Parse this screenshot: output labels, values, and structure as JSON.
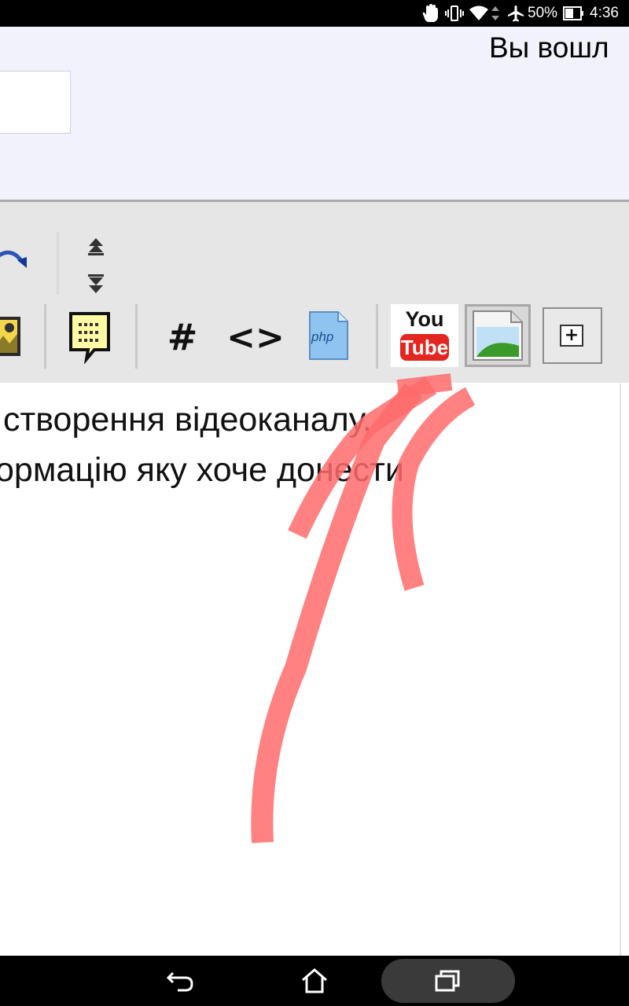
{
  "status_bar": {
    "battery": "50%",
    "time": "4:36",
    "icons": [
      "hand-touch-icon",
      "vibrate-icon",
      "wifi-icon",
      "data-transfer-icon",
      "airplane-icon",
      "battery-icon"
    ]
  },
  "header": {
    "login_text": "Вы вошл"
  },
  "toolbar": {
    "buttons": [
      {
        "name": "redo-icon"
      },
      {
        "name": "collapse-up-icon"
      },
      {
        "name": "expand-down-icon"
      },
      {
        "name": "insert-image-icon"
      },
      {
        "name": "insert-quote-icon"
      },
      {
        "name": "hashtag-icon",
        "label": "#"
      },
      {
        "name": "code-icon",
        "label": "<>"
      },
      {
        "name": "php-icon",
        "label": "php"
      },
      {
        "name": "youtube-icon",
        "top": "You",
        "bottom": "Tube"
      },
      {
        "name": "picture-icon"
      },
      {
        "name": "add-more-icon",
        "label": "+"
      }
    ]
  },
  "editor": {
    "line1": "створення відеоканалу,",
    "line2": "ормацію яку хоче донести"
  },
  "annotation": {
    "arrow_color": "#ff6b6b"
  },
  "nav_bar": {
    "buttons": [
      "back-icon",
      "home-icon",
      "recents-icon"
    ]
  }
}
